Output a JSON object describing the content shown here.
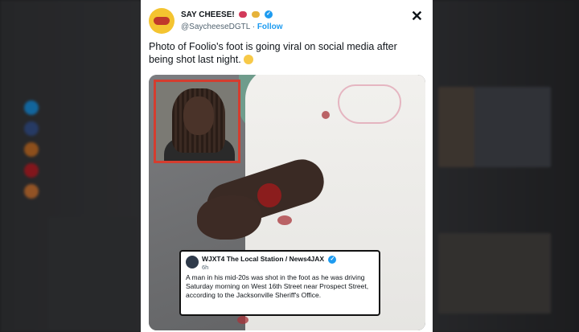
{
  "tweet": {
    "display_name": "SAY CHEESE!",
    "handle": "@SaycheeseDGTL",
    "separator": " · ",
    "follow_label": "Follow",
    "close_icon": "x-logo-icon",
    "text": "Photo of Foolio's foot is going viral on social media after being shot last night."
  },
  "embedded_post": {
    "account": "WJXT4 The Local Station / News4JAX",
    "time": "6h",
    "body": "A man in his mid-20s was shot in the foot as he was driving Saturday morning on West 16th Street near Prospect Street, according to the Jacksonville Sheriff's Office."
  },
  "colors": {
    "accent": "#1d9bf0",
    "inset_border": "#d43d2f"
  }
}
